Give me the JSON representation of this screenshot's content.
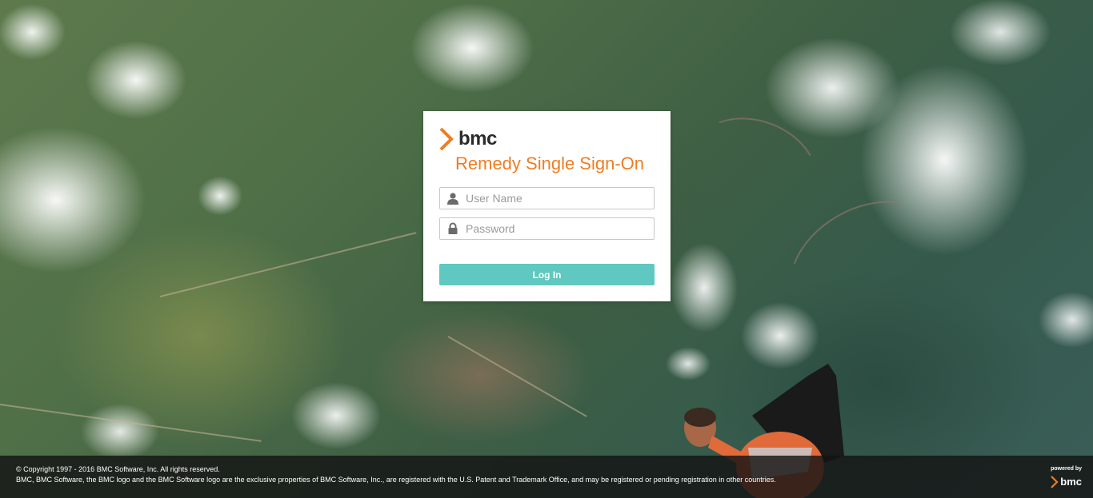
{
  "brand": {
    "logo_text": "bmc",
    "accent_color": "#ef7d22",
    "button_color": "#5fc8c0"
  },
  "login": {
    "title": "Remedy Single Sign-On",
    "username_placeholder": "User Name",
    "username_icon": "user-icon",
    "password_placeholder": "Password",
    "password_icon": "lock-icon",
    "login_button": "Log In"
  },
  "footer": {
    "copyright_line1": "© Copyright 1997 - 2016 BMC Software, Inc. All rights reserved.",
    "copyright_line2": "BMC, BMC Software, the BMC logo and the BMC Software logo are the exclusive properties of BMC Software, Inc., are registered with the U.S. Patent and Trademark Office, and may be registered or pending registration in other countries.",
    "powered_by": "powered by",
    "powered_logo_text": "bmc"
  }
}
